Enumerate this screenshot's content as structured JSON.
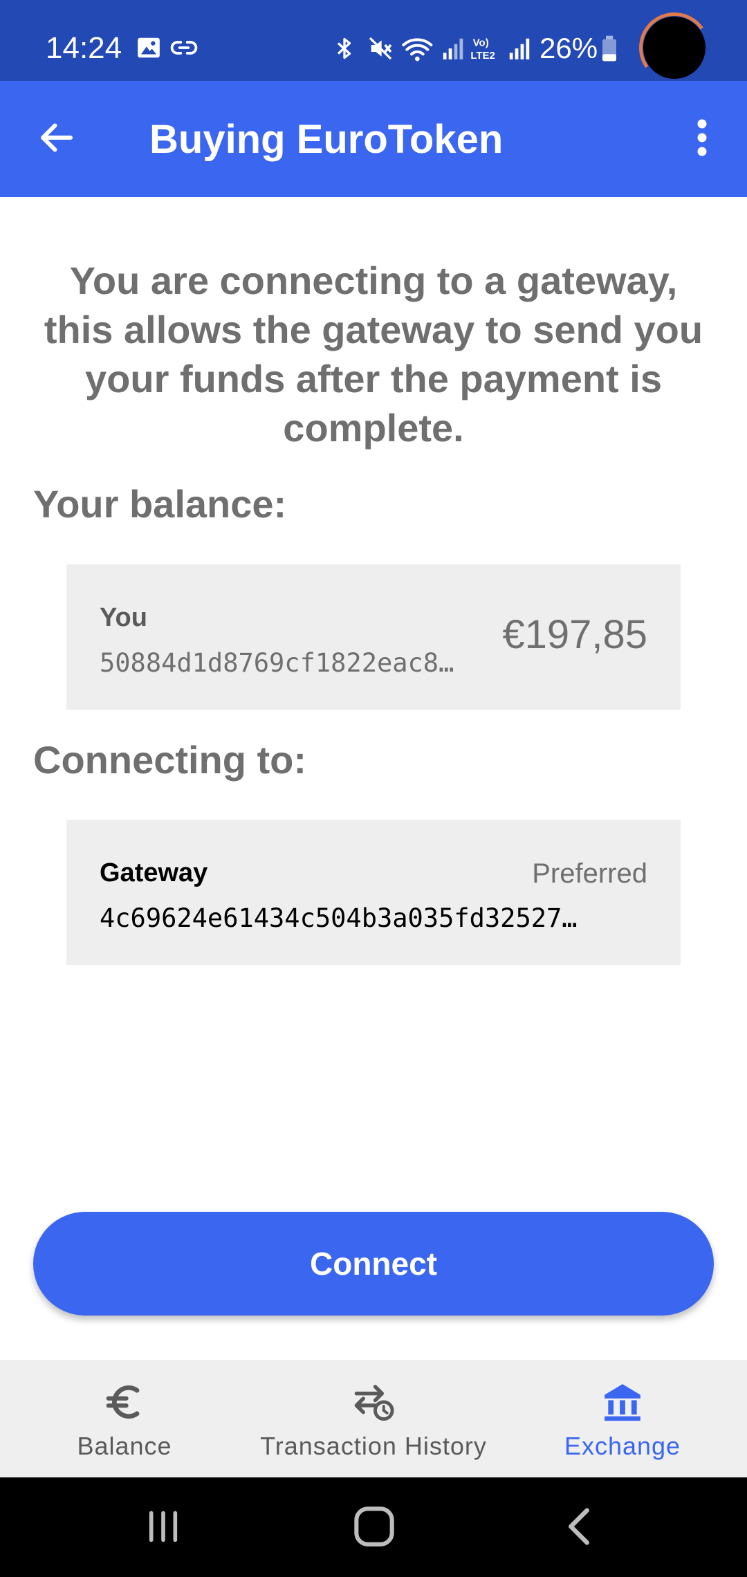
{
  "status_bar": {
    "time": "14:24",
    "battery": "26%",
    "icons": [
      "image-icon",
      "link-icon",
      "bluetooth-icon",
      "mute-icon",
      "wifi-icon",
      "signal-icon",
      "volte-icon",
      "signal-icon",
      "battery-icon"
    ]
  },
  "app_bar": {
    "title": "Buying EuroToken",
    "back_icon": "arrow-left-icon",
    "menu_icon": "more-vert-icon"
  },
  "intro_text": "You are connecting to a gateway, this allows the gateway to send you your funds after the payment is complete.",
  "balance_section": {
    "label": "Your balance:",
    "card": {
      "name": "You",
      "public_key": "50884d1d8769cf1822eac8…",
      "amount": "€197,85"
    }
  },
  "gateway_section": {
    "label": "Connecting to:",
    "card": {
      "name": "Gateway",
      "tag": "Preferred",
      "public_key": "4c69624e61434c504b3a035fd32527…"
    }
  },
  "connect_button": {
    "label": "Connect"
  },
  "bottom_nav": {
    "items": [
      {
        "label": "Balance",
        "icon": "euro-icon",
        "active": false
      },
      {
        "label": "Transaction History",
        "icon": "history-swap-icon",
        "active": false
      },
      {
        "label": "Exchange",
        "icon": "bank-icon",
        "active": true
      }
    ]
  },
  "colors": {
    "status_bar": "#2249b4",
    "primary": "#3a66f0",
    "text_secondary": "#6f6f6f",
    "card_bg": "#eeeeee",
    "nav_bg": "#efefef"
  }
}
